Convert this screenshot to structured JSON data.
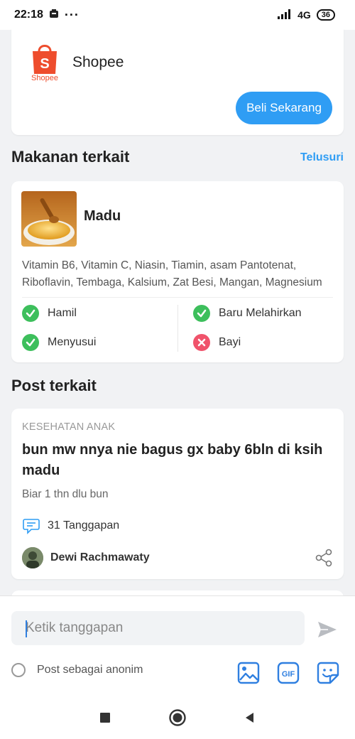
{
  "status_bar": {
    "time": "22:18",
    "more_dots": "···",
    "network": "4G",
    "battery": "36"
  },
  "shopee": {
    "logo_text": "Shopee",
    "name": "Shopee",
    "buy_label": "Beli Sekarang"
  },
  "related_foods": {
    "title": "Makanan terkait",
    "browse_label": "Telusuri",
    "food": {
      "name": "Madu",
      "nutrients": "Vitamin B6, Vitamin C, Niasin, Tiamin, asam Pantotenat, Riboflavin, Tembaga, Kalsium, Zat Besi, Mangan, Magnesium",
      "statuses": [
        {
          "label": "Hamil",
          "ok": true
        },
        {
          "label": "Baru Melahirkan",
          "ok": true
        },
        {
          "label": "Menyusui",
          "ok": true
        },
        {
          "label": "Bayi",
          "ok": false
        }
      ]
    }
  },
  "related_posts": {
    "title": "Post terkait",
    "post": {
      "category": "KESEHATAN ANAK",
      "title": "bun mw nnya nie bagus gx baby 6bln di ksih madu",
      "body": "Biar 1 thn dlu bun",
      "replies": "31 Tanggapan",
      "author": "Dewi Rachmawaty"
    }
  },
  "composer": {
    "placeholder": "Ketik tanggapan",
    "anonymous_label": "Post sebagai anonim",
    "gif_label": "GIF"
  },
  "colors": {
    "accent": "#2f9df4",
    "shopee": "#ee4d2d",
    "ok": "#3dbf5c",
    "no": "#f0536b"
  }
}
